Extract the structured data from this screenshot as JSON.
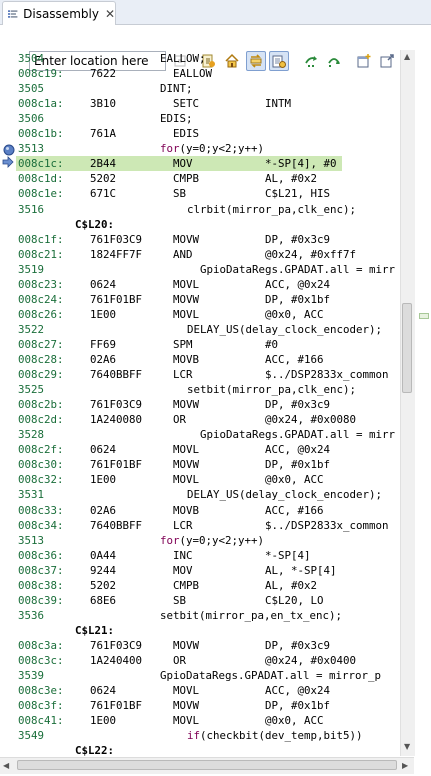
{
  "tab": {
    "title": "Disassembly",
    "close": "✕"
  },
  "location": {
    "placeholder": "Enter location here",
    "value": ""
  },
  "lines": [
    {
      "kind": "src",
      "num": "3504",
      "text": "EALLOW;",
      "indent": 160
    },
    {
      "kind": "asm",
      "addr": "008c19:",
      "op": "7622",
      "mn": "EALLOW",
      "args": ""
    },
    {
      "kind": "src",
      "num": "3505",
      "text": "DINT;",
      "indent": 160
    },
    {
      "kind": "asm",
      "addr": "008c1a:",
      "op": "3B10",
      "mn": "SETC",
      "args": "INTM"
    },
    {
      "kind": "src",
      "num": "3506",
      "text": "EDIS;",
      "indent": 160
    },
    {
      "kind": "asm",
      "addr": "008c1b:",
      "op": "761A",
      "mn": "EDIS",
      "args": ""
    },
    {
      "kind": "src",
      "num": "3513",
      "kw": "for",
      "text": "(y=0;y<2;y++)",
      "indent": 160
    },
    {
      "kind": "asm",
      "addr": "008c1c:",
      "op": "2B44",
      "mn": "MOV",
      "args": "*-SP[4], #0",
      "current": true
    },
    {
      "kind": "asm",
      "addr": "008c1d:",
      "op": "5202",
      "mn": "CMPB",
      "args": "AL, #0x2"
    },
    {
      "kind": "asm",
      "addr": "008c1e:",
      "op": "671C",
      "mn": "SB",
      "args": "C$L21, HIS"
    },
    {
      "kind": "src",
      "num": "3516",
      "text": "clrbit(mirror_pa,clk_enc);",
      "indent": 187
    },
    {
      "kind": "label",
      "text": "C$L20:"
    },
    {
      "kind": "asm",
      "addr": "008c1f:",
      "op": "761F03C9",
      "mn": "MOVW",
      "args": "DP, #0x3c9"
    },
    {
      "kind": "asm",
      "addr": "008c21:",
      "op": "1824FF7F",
      "mn": "AND",
      "args": "@0x24, #0xff7f"
    },
    {
      "kind": "src",
      "num": "3519",
      "text": "GpioDataRegs.GPADAT.all = mirr",
      "indent": 200
    },
    {
      "kind": "asm",
      "addr": "008c23:",
      "op": "0624",
      "mn": "MOVL",
      "args": "ACC, @0x24"
    },
    {
      "kind": "asm",
      "addr": "008c24:",
      "op": "761F01BF",
      "mn": "MOVW",
      "args": "DP, #0x1bf"
    },
    {
      "kind": "asm",
      "addr": "008c26:",
      "op": "1E00",
      "mn": "MOVL",
      "args": "@0x0, ACC"
    },
    {
      "kind": "src",
      "num": "3522",
      "text": "DELAY_US(delay_clock_encoder);",
      "indent": 187
    },
    {
      "kind": "asm",
      "addr": "008c27:",
      "op": "FF69",
      "mn": "SPM",
      "args": "#0"
    },
    {
      "kind": "asm",
      "addr": "008c28:",
      "op": "02A6",
      "mn": "MOVB",
      "args": "ACC, #166"
    },
    {
      "kind": "asm",
      "addr": "008c29:",
      "op": "7640BBFF",
      "mn": "LCR",
      "args": "$../DSP2833x_common"
    },
    {
      "kind": "src",
      "num": "3525",
      "text": "setbit(mirror_pa,clk_enc);",
      "indent": 187
    },
    {
      "kind": "asm",
      "addr": "008c2b:",
      "op": "761F03C9",
      "mn": "MOVW",
      "args": "DP, #0x3c9"
    },
    {
      "kind": "asm",
      "addr": "008c2d:",
      "op": "1A240080",
      "mn": "OR",
      "args": "@0x24, #0x0080"
    },
    {
      "kind": "src",
      "num": "3528",
      "text": "GpioDataRegs.GPADAT.all = mirr",
      "indent": 200
    },
    {
      "kind": "asm",
      "addr": "008c2f:",
      "op": "0624",
      "mn": "MOVL",
      "args": "ACC, @0x24"
    },
    {
      "kind": "asm",
      "addr": "008c30:",
      "op": "761F01BF",
      "mn": "MOVW",
      "args": "DP, #0x1bf"
    },
    {
      "kind": "asm",
      "addr": "008c32:",
      "op": "1E00",
      "mn": "MOVL",
      "args": "@0x0, ACC"
    },
    {
      "kind": "src",
      "num": "3531",
      "text": "DELAY_US(delay_clock_encoder);",
      "indent": 187
    },
    {
      "kind": "asm",
      "addr": "008c33:",
      "op": "02A6",
      "mn": "MOVB",
      "args": "ACC, #166"
    },
    {
      "kind": "asm",
      "addr": "008c34:",
      "op": "7640BBFF",
      "mn": "LCR",
      "args": "$../DSP2833x_common"
    },
    {
      "kind": "src",
      "num": "3513",
      "kw": "for",
      "text": "(y=0;y<2;y++)",
      "indent": 160
    },
    {
      "kind": "asm",
      "addr": "008c36:",
      "op": "0A44",
      "mn": "INC",
      "args": "*-SP[4]"
    },
    {
      "kind": "asm",
      "addr": "008c37:",
      "op": "9244",
      "mn": "MOV",
      "args": "AL, *-SP[4]"
    },
    {
      "kind": "asm",
      "addr": "008c38:",
      "op": "5202",
      "mn": "CMPB",
      "args": "AL, #0x2"
    },
    {
      "kind": "asm",
      "addr": "008c39:",
      "op": "68E6",
      "mn": "SB",
      "args": "C$L20, LO"
    },
    {
      "kind": "src",
      "num": "3536",
      "text": "setbit(mirror_pa,en_tx_enc);",
      "indent": 160
    },
    {
      "kind": "label",
      "text": "C$L21:"
    },
    {
      "kind": "asm",
      "addr": "008c3a:",
      "op": "761F03C9",
      "mn": "MOVW",
      "args": "DP, #0x3c9"
    },
    {
      "kind": "asm",
      "addr": "008c3c:",
      "op": "1A240400",
      "mn": "OR",
      "args": "@0x24, #0x0400"
    },
    {
      "kind": "src",
      "num": "3539",
      "text": "GpioDataRegs.GPADAT.all = mirror_p",
      "indent": 160
    },
    {
      "kind": "asm",
      "addr": "008c3e:",
      "op": "0624",
      "mn": "MOVL",
      "args": "ACC, @0x24"
    },
    {
      "kind": "asm",
      "addr": "008c3f:",
      "op": "761F01BF",
      "mn": "MOVW",
      "args": "DP, #0x1bf"
    },
    {
      "kind": "asm",
      "addr": "008c41:",
      "op": "1E00",
      "mn": "MOVL",
      "args": "@0x0, ACC"
    },
    {
      "kind": "src",
      "num": "3549",
      "kw": "if",
      "text": "(checkbit(dev_temp,bit5))",
      "indent": 187
    },
    {
      "kind": "label",
      "text": "C$L22:"
    }
  ],
  "colors": {
    "address": "#1a6e3a",
    "keyword": "#7f0055",
    "current_line": "#cde8b5"
  },
  "toolbar_icons": [
    "home-icon",
    "link-with-editor-icon",
    "sync-icon",
    "step-into-icon",
    "step-over-icon",
    "new-view-icon",
    "pin-icon",
    "view-menu-icon"
  ]
}
